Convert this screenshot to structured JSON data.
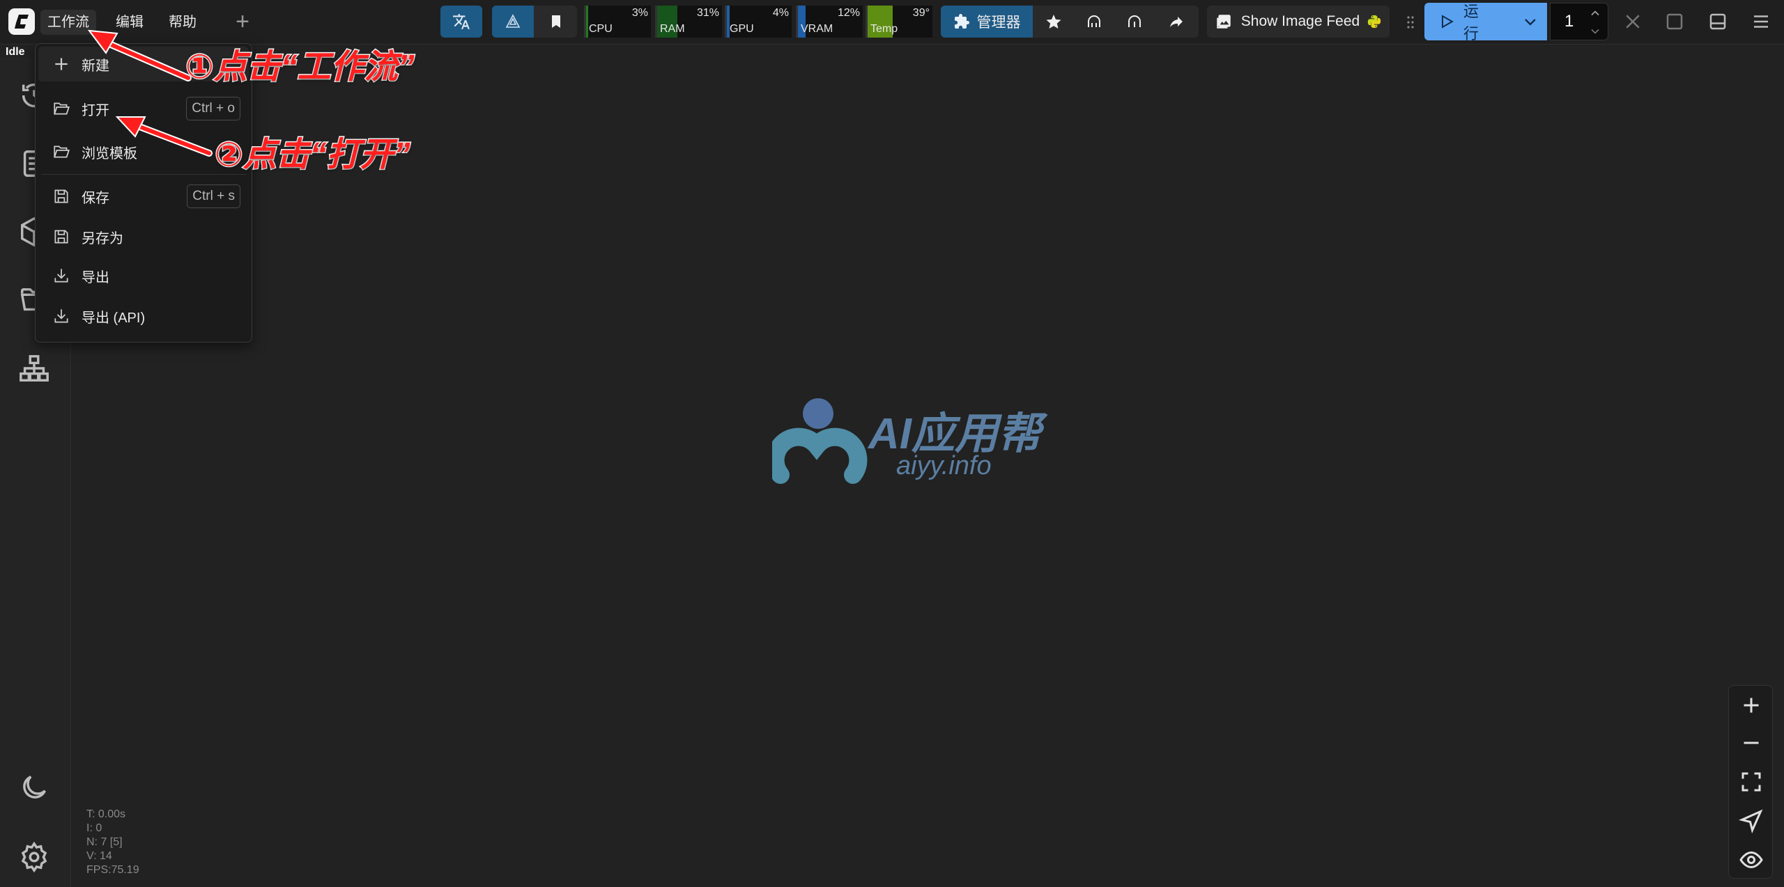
{
  "menubar": {
    "tabs": [
      "工作流",
      "编辑",
      "帮助"
    ]
  },
  "status": "Idle",
  "monitors": [
    {
      "label": "CPU",
      "value": "3%",
      "percent": 3,
      "color": "#1f7a1f"
    },
    {
      "label": "RAM",
      "value": "31%",
      "percent": 31,
      "color": "#16551b"
    },
    {
      "label": "GPU",
      "value": "4%",
      "percent": 4,
      "color": "#1e5fa8"
    },
    {
      "label": "VRAM",
      "value": "12%",
      "percent": 12,
      "color": "#1e5fa8"
    },
    {
      "label": "Temp",
      "value": "39°",
      "percent": 39,
      "color": "#5f8f12"
    }
  ],
  "toolbar": {
    "manager_label": "管理器",
    "image_feed_label": "Show Image Feed",
    "run_label": "运行",
    "queue_count": "1"
  },
  "workflow_menu": {
    "items": [
      {
        "label": "新建",
        "icon": "plus-icon"
      },
      {
        "label": "打开",
        "icon": "folder-open-icon",
        "shortcut": "Ctrl + o"
      },
      {
        "label": "浏览模板",
        "icon": "folder-open-icon"
      },
      {
        "label": "保存",
        "icon": "save-icon",
        "shortcut": "Ctrl + s"
      },
      {
        "label": "另存为",
        "icon": "save-icon"
      },
      {
        "label": "导出",
        "icon": "download-icon"
      },
      {
        "label": "导出 (API)",
        "icon": "download-icon"
      }
    ]
  },
  "annotations": {
    "step1": "①点击“工作流”",
    "step2": "②点击“打开”"
  },
  "watermark": {
    "title": "AI应用帮",
    "subtitle": "aiyy.info"
  },
  "stats": {
    "t": "T: 0.00s",
    "i": "I: 0",
    "n": "N: 7 [5]",
    "v": "V: 14",
    "fps": "FPS:75.19"
  },
  "colors": {
    "accent_blue": "#5aa2f0",
    "annotation_red": "#ff1e1e",
    "canvas": "#222222"
  }
}
